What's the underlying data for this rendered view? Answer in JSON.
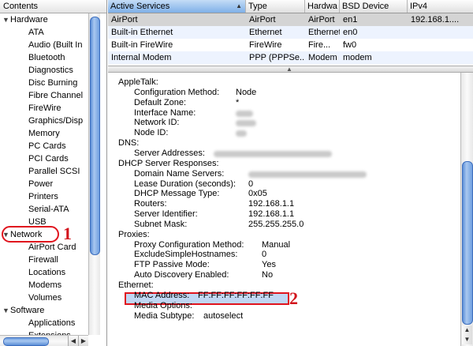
{
  "sidebar": {
    "header": "Contents",
    "items": [
      {
        "kind": "group",
        "label": "Hardware"
      },
      {
        "kind": "child",
        "label": "ATA"
      },
      {
        "kind": "child",
        "label": "Audio (Built In"
      },
      {
        "kind": "child",
        "label": "Bluetooth"
      },
      {
        "kind": "child",
        "label": "Diagnostics"
      },
      {
        "kind": "child",
        "label": "Disc Burning"
      },
      {
        "kind": "child",
        "label": "Fibre Channel"
      },
      {
        "kind": "child",
        "label": "FireWire"
      },
      {
        "kind": "child",
        "label": "Graphics/Disp"
      },
      {
        "kind": "child",
        "label": "Memory"
      },
      {
        "kind": "child",
        "label": "PC Cards"
      },
      {
        "kind": "child",
        "label": "PCI Cards"
      },
      {
        "kind": "child",
        "label": "Parallel SCSI"
      },
      {
        "kind": "child",
        "label": "Power"
      },
      {
        "kind": "child",
        "label": "Printers"
      },
      {
        "kind": "child",
        "label": "Serial-ATA"
      },
      {
        "kind": "child",
        "label": "USB"
      },
      {
        "kind": "group",
        "label": "Network"
      },
      {
        "kind": "child",
        "label": "AirPort Card"
      },
      {
        "kind": "child",
        "label": "Firewall"
      },
      {
        "kind": "child",
        "label": "Locations"
      },
      {
        "kind": "child",
        "label": "Modems"
      },
      {
        "kind": "child",
        "label": "Volumes"
      },
      {
        "kind": "group",
        "label": "Software"
      },
      {
        "kind": "child",
        "label": "Applications"
      },
      {
        "kind": "child",
        "label": "Extensions"
      }
    ]
  },
  "annotations": {
    "marker1": "1",
    "marker2": "2"
  },
  "table": {
    "columns": [
      "Active Services",
      "Type",
      "Hardwa",
      "BSD Device",
      "IPv4"
    ],
    "rows": [
      [
        "AirPort",
        "AirPort",
        "AirPort",
        "en1",
        "192.168.1...."
      ],
      [
        "Built-in Ethernet",
        "Ethernet",
        "Ethernet",
        "en0",
        ""
      ],
      [
        "Built-in FireWire",
        "FireWire",
        "Fire...",
        "fw0",
        ""
      ],
      [
        "Internal Modem",
        "PPP (PPPSe...",
        "Modem",
        "modem",
        ""
      ]
    ]
  },
  "detail": {
    "lines": [
      {
        "indent": 0,
        "label": "AppleTalk:",
        "value": ""
      },
      {
        "indent": 1,
        "label": "Configuration Method:",
        "value": "Node"
      },
      {
        "indent": 1,
        "label": "Default Zone:",
        "value": "*"
      },
      {
        "indent": 1,
        "label": "Interface Name:",
        "value": "",
        "redacted": true,
        "w": 22
      },
      {
        "indent": 1,
        "label": "Network ID:",
        "value": "",
        "redacted": true,
        "w": 26
      },
      {
        "indent": 1,
        "label": "Node ID:",
        "value": "",
        "redacted": true,
        "w": 14
      },
      {
        "indent": 0,
        "label": "DNS:",
        "value": ""
      },
      {
        "indent": 1,
        "label": "Server Addresses:",
        "value": "",
        "redacted": true,
        "w": 150
      },
      {
        "indent": 0,
        "label": "DHCP Server Responses:",
        "value": ""
      },
      {
        "indent": 1,
        "label": "Domain Name Servers:",
        "value": "",
        "redacted": true,
        "w": 150
      },
      {
        "indent": 1,
        "label": "Lease Duration (seconds):",
        "value": "0"
      },
      {
        "indent": 1,
        "label": "DHCP Message Type:",
        "value": "0x05"
      },
      {
        "indent": 1,
        "label": "Routers:",
        "value": "192.168.1.1"
      },
      {
        "indent": 1,
        "label": "Server Identifier:",
        "value": "192.168.1.1"
      },
      {
        "indent": 1,
        "label": "Subnet Mask:",
        "value": "255.255.255.0"
      },
      {
        "indent": 0,
        "label": "Proxies:",
        "value": ""
      },
      {
        "indent": 1,
        "label": "Proxy Configuration Method:",
        "value": "Manual"
      },
      {
        "indent": 1,
        "label": "ExcludeSimpleHostnames:",
        "value": "0"
      },
      {
        "indent": 1,
        "label": "FTP Passive Mode:",
        "value": "Yes"
      },
      {
        "indent": 1,
        "label": "Auto Discovery Enabled:",
        "value": "No"
      },
      {
        "indent": 0,
        "label": "Ethernet:",
        "value": ""
      },
      {
        "indent": 1,
        "label": "MAC Address:",
        "value": "FF:FF:FF:FF:FF:FF",
        "highlight": true
      },
      {
        "indent": 1,
        "label": "Media Options:",
        "value": ""
      },
      {
        "indent": 1,
        "label": "Media Subtype:",
        "value": "autoselect"
      }
    ]
  },
  "colors": {
    "annotation_red": "#e0141e",
    "selection_blue": "#c0d7f4",
    "scroll_blue": "#5c8fd8"
  }
}
